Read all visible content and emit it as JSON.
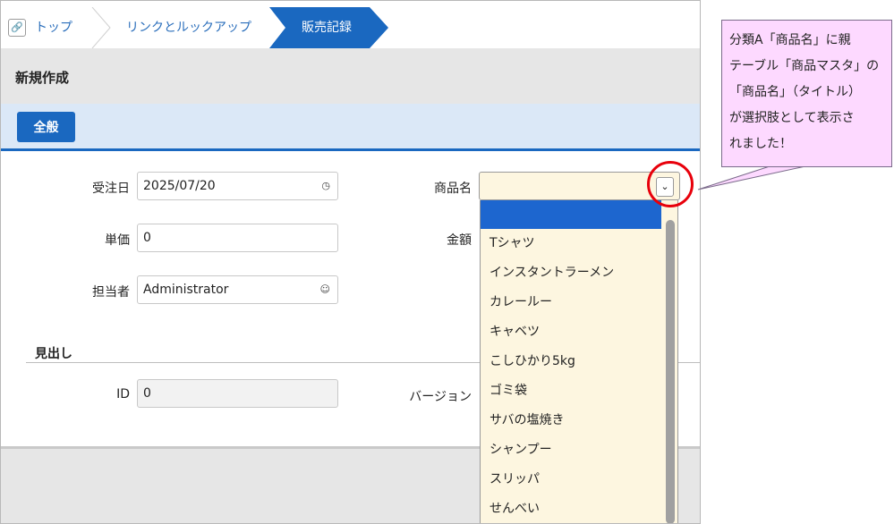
{
  "breadcrumb": {
    "items": [
      "トップ",
      "リンクとルックアップ",
      "販売記録"
    ]
  },
  "page": {
    "title": "新規作成"
  },
  "tabs": [
    {
      "label": "全般"
    }
  ],
  "form": {
    "order_date": {
      "label": "受注日",
      "value": "2025/07/20"
    },
    "unit_price": {
      "label": "単価",
      "value": "0"
    },
    "owner": {
      "label": "担当者",
      "value": "Administrator"
    },
    "product_name": {
      "label": "商品名",
      "value": ""
    },
    "amount": {
      "label": "金額"
    }
  },
  "section": {
    "title": "見出し",
    "id": {
      "label": "ID",
      "value": "0"
    },
    "version": {
      "label": "バージョン"
    }
  },
  "dropdown": {
    "options": [
      "",
      "Tシャツ",
      "インスタントラーメン",
      "カレールー",
      "キャベツ",
      "こしひかり5kg",
      "ゴミ袋",
      "サバの塩焼き",
      "シャンプー",
      "スリッパ",
      "せんべい"
    ]
  },
  "callout": {
    "lines": [
      "分類A「商品名」に親",
      "テーブル「商品マスタ」の",
      "「商品名」（タイトル）",
      "が選択肢として表示さ",
      "れました！"
    ]
  },
  "colors": {
    "accent": "#1a68c0",
    "highlight": "#e8000b",
    "callout_bg": "#fdd9ff"
  }
}
